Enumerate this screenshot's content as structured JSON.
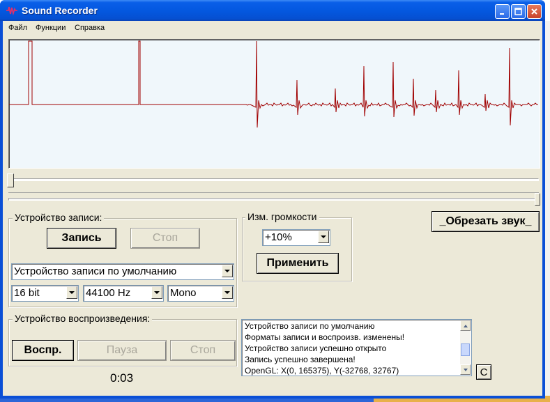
{
  "window": {
    "title": "Sound Recorder"
  },
  "menu": [
    "Файл",
    "Функции",
    "Справка"
  ],
  "recording": {
    "group_label": "Устройство записи:",
    "record_label": "Запись",
    "stop_label": "Стоп",
    "device": "Устройство записи по умолчанию",
    "bits": "16 bit",
    "rate": "44100 Hz",
    "channels": "Mono"
  },
  "volume": {
    "group_label": "Изм. громкости",
    "value": "+10%",
    "apply_label": "Применить"
  },
  "trim_label": "_Обрезать звук_",
  "playback": {
    "group_label": "Устройство воспроизведения:",
    "play_label": "Воспр.",
    "pause_label": "Пауза",
    "stop_label": "Стоп"
  },
  "timer": "0:03",
  "log": [
    "Устройство записи по умолчанию",
    "Форматы записи и воспроизв. изменены!",
    "Устройство записи успешно открыто",
    "Запись успешно завершена!",
    "OpenGL: X(0, 165375), Y(-32768, 32767)"
  ],
  "clear_label": "C",
  "colors": {
    "waveform": "#a00000",
    "wave_bg": "#f0f7fb",
    "titlebar": "#0458e0",
    "face": "#ece9d8"
  }
}
